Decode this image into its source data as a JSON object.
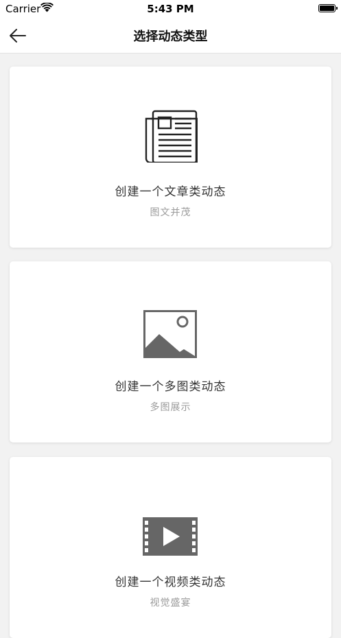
{
  "status_bar": {
    "carrier": "Carrier",
    "time": "5:43 PM",
    "wifi_icon": "wifi-icon",
    "battery_icon": "battery-icon",
    "battery_level": 1.0
  },
  "nav": {
    "back_icon": "arrow-left-icon",
    "title": "选择动态类型"
  },
  "cards": [
    {
      "icon": "newspaper-icon",
      "title": "创建一个文章类动态",
      "subtitle": "图文并茂"
    },
    {
      "icon": "image-icon",
      "title": "创建一个多图类动态",
      "subtitle": "多图展示"
    },
    {
      "icon": "video-icon",
      "title": "创建一个视频类动态",
      "subtitle": "视觉盛宴"
    }
  ],
  "colors": {
    "background": "#f2f2f2",
    "card": "#ffffff",
    "icon": "#666666",
    "title_text": "#333333",
    "subtitle_text": "#9a9a9a"
  }
}
